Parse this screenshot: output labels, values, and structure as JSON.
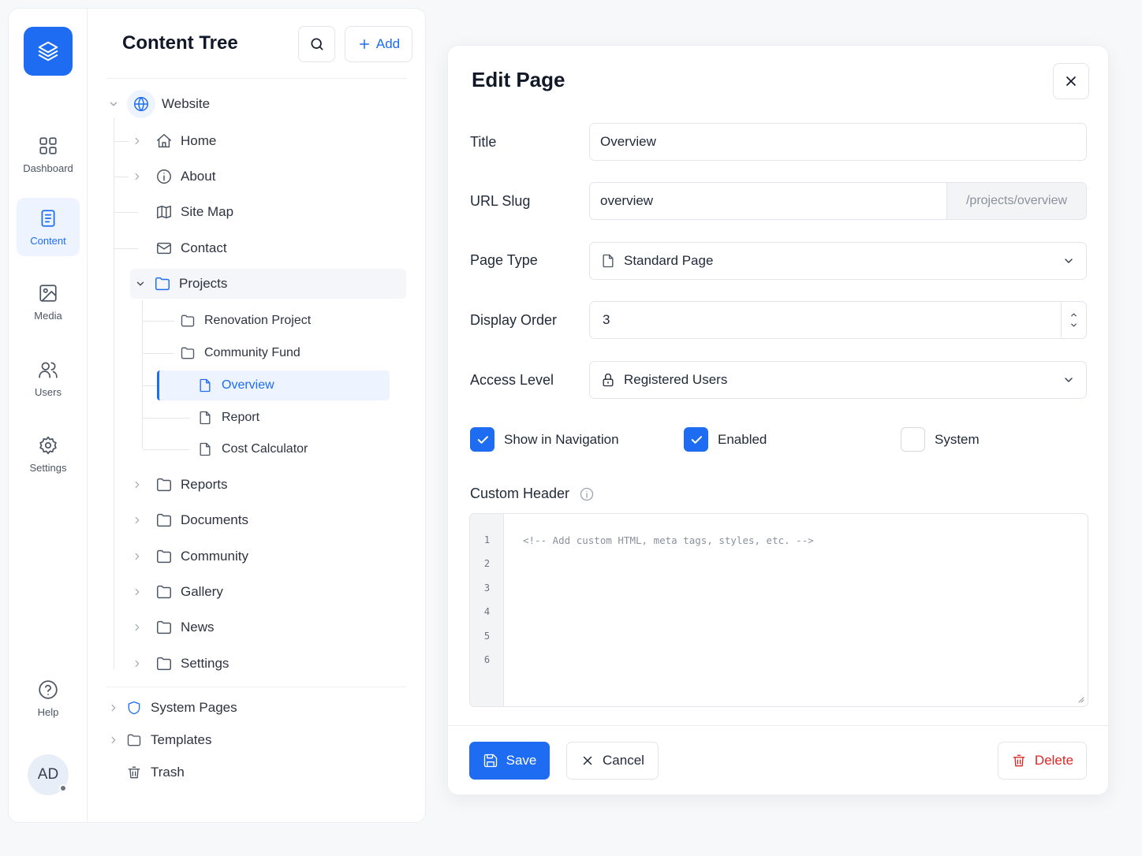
{
  "rail": {
    "items": [
      {
        "label": "Dashboard",
        "icon": "grid-icon"
      },
      {
        "label": "Content",
        "icon": "document-icon"
      },
      {
        "label": "Media",
        "icon": "image-icon"
      },
      {
        "label": "Users",
        "icon": "users-icon"
      },
      {
        "label": "Settings",
        "icon": "gear-icon"
      }
    ],
    "help_label": "Help",
    "avatar_initials": "AD",
    "accent_color": "#1d6cf2"
  },
  "tree": {
    "title": "Content Tree",
    "add_label": "Add",
    "root_label": "Website",
    "items": {
      "home": "Home",
      "about": "About",
      "sitemap": "Site Map",
      "contact": "Contact",
      "projects": "Projects",
      "renovation": "Renovation Project",
      "community_fund": "Community Fund",
      "overview": "Overview",
      "report": "Report",
      "cost_calculator": "Cost Calculator",
      "reports": "Reports",
      "documents": "Documents",
      "community": "Community",
      "gallery": "Gallery",
      "news": "News",
      "settings": "Settings"
    },
    "bottom": {
      "system_pages": "System Pages",
      "templates": "Templates",
      "trash": "Trash"
    }
  },
  "edit": {
    "title": "Edit Page",
    "fields": {
      "title_label": "Title",
      "title_value": "Overview",
      "slug_label": "URL Slug",
      "slug_value": "overview",
      "slug_suffix": "/projects/overview",
      "page_type_label": "Page Type",
      "page_type_value": "Standard Page",
      "display_order_label": "Display Order",
      "display_order_value": "3",
      "access_label": "Access Level",
      "access_value": "Registered Users"
    },
    "checkboxes": [
      {
        "label": "Show in Navigation",
        "checked": true
      },
      {
        "label": "Enabled",
        "checked": true
      },
      {
        "label": "System",
        "checked": false
      }
    ],
    "custom_header_label": "Custom Header",
    "editor": {
      "line_numbers": [
        "1",
        "2",
        "3",
        "4",
        "5",
        "6"
      ],
      "placeholder": "<!-- Add custom HTML, meta tags, styles, etc. -->"
    },
    "buttons": {
      "save": "Save",
      "cancel": "Cancel",
      "delete": "Delete"
    },
    "danger_color": "#dc2626"
  }
}
